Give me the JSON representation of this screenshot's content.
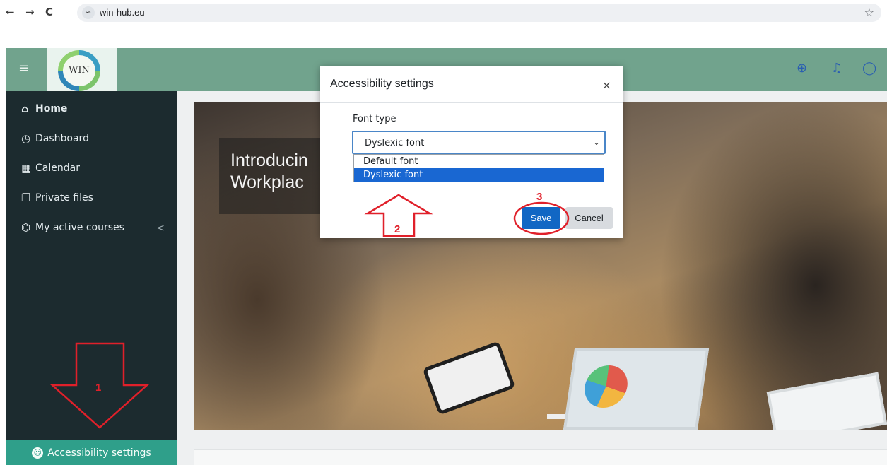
{
  "browser": {
    "back_glyph": "←",
    "forward_glyph": "→",
    "reload_glyph": "C",
    "site_info_glyph": "≈",
    "url": "win-hub.eu",
    "bookmark_glyph": "☆"
  },
  "header": {
    "menu_glyph": "≡",
    "logo_text": "WIN",
    "language_glyph": "⊕",
    "notifications_glyph": "♫",
    "messages_glyph": "◯",
    "colors": {
      "header_bg": "#71a38d",
      "icon": "#2b5fb0"
    }
  },
  "sidebar": {
    "items": [
      {
        "label": "Home",
        "icon": "⌂"
      },
      {
        "label": "Dashboard",
        "icon": "◷"
      },
      {
        "label": "Calendar",
        "icon": "▦"
      },
      {
        "label": "Private files",
        "icon": "❐"
      },
      {
        "label": "My active courses",
        "icon": "⌬"
      }
    ],
    "courses_chevron": "<",
    "footer_label": "Accessibility settings",
    "footer_icon": "☺",
    "colors": {
      "bg": "#1c2b2f",
      "footer_bg": "#2f9f8a"
    }
  },
  "hero": {
    "caption_line1": "Introducin",
    "caption_line2": "Workplac"
  },
  "modal": {
    "title": "Accessibility settings",
    "close_glyph": "×",
    "field_label": "Font type",
    "selected_value": "Dyslexic font",
    "chevron_glyph": "⌄",
    "options": [
      "Default font",
      "Dyslexic font"
    ],
    "save_label": "Save",
    "cancel_label": "Cancel",
    "colors": {
      "primary": "#1167c4",
      "highlight": "#1967d2"
    }
  },
  "annotations": {
    "step1": "1",
    "step2": "2",
    "step3": "3",
    "color": "#e0202a"
  }
}
